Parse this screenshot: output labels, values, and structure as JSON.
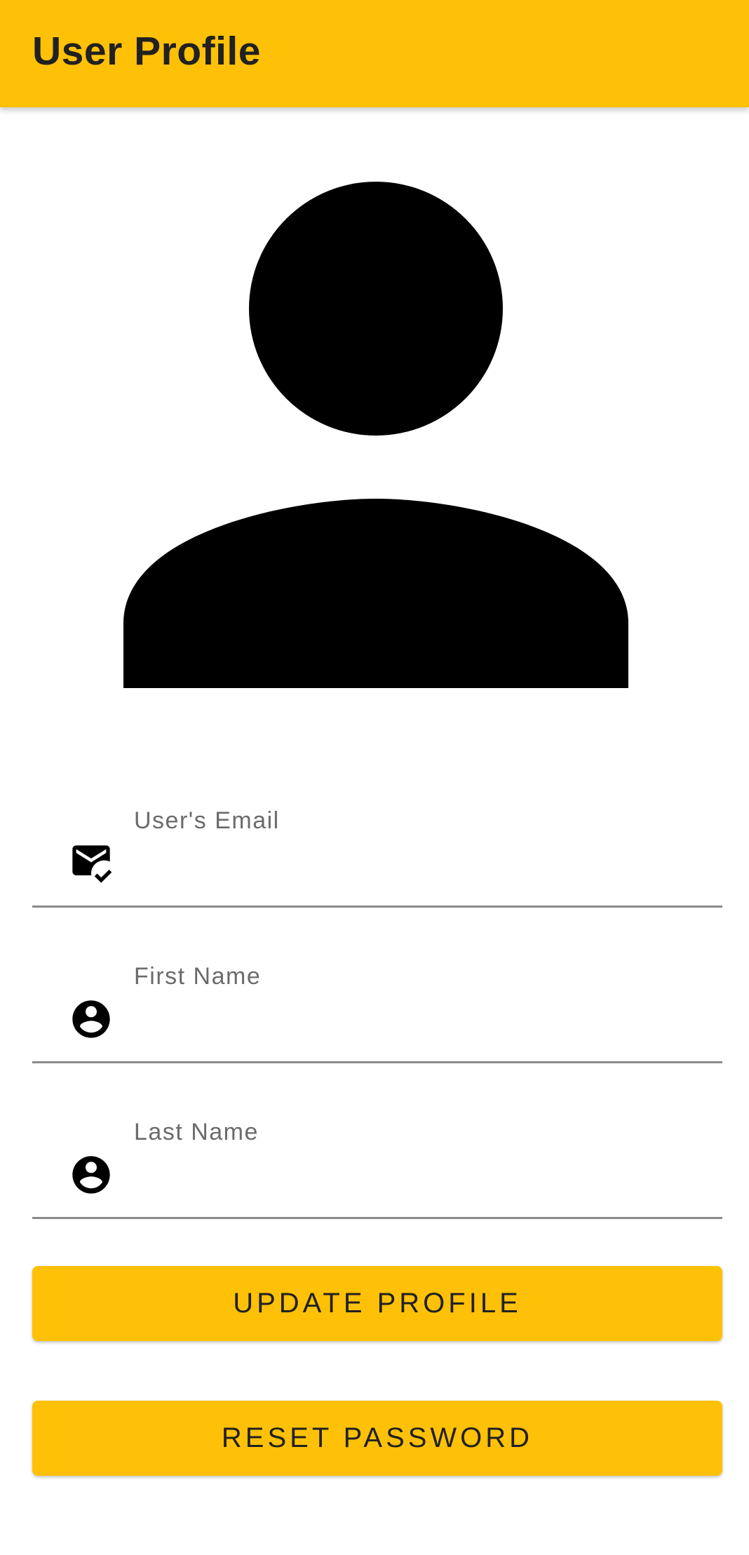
{
  "app_bar": {
    "title": "User Profile",
    "color": "#FFC107"
  },
  "avatar": {
    "icon": "person-silhouette-icon"
  },
  "form": {
    "email": {
      "label": "User's Email",
      "value": "",
      "icon": "mark-email-read-icon"
    },
    "first_name": {
      "label": "First Name",
      "value": "",
      "icon": "account-circle-icon"
    },
    "last_name": {
      "label": "Last Name",
      "value": "",
      "icon": "account-circle-icon"
    }
  },
  "buttons": {
    "update_label": "UPDATE PROFILE",
    "reset_label": "RESET PASSWORD"
  }
}
